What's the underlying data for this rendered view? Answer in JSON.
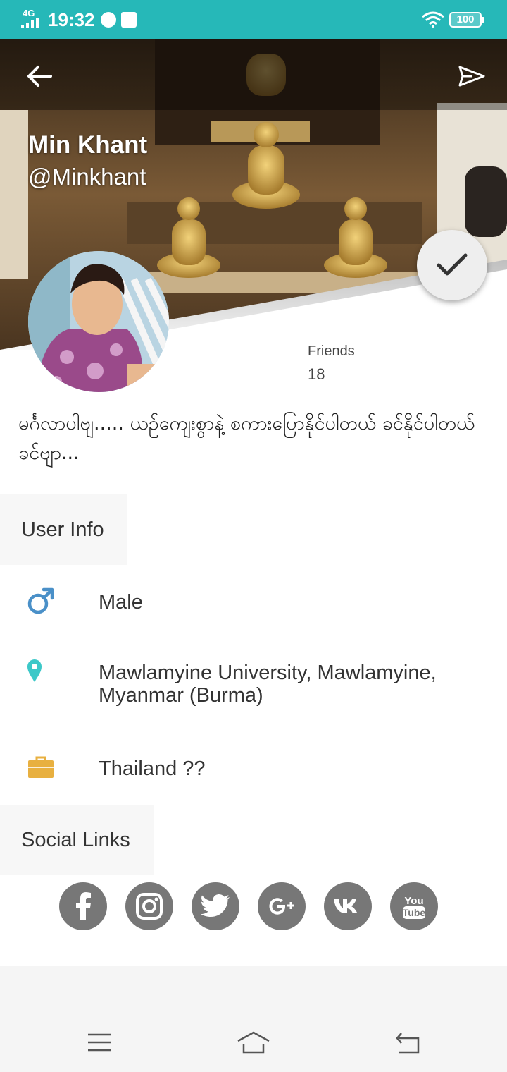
{
  "status_bar": {
    "network": "4G",
    "time": "19:32",
    "battery": "100"
  },
  "profile": {
    "name": "Min Khant",
    "handle": "@Minkhant",
    "friends_label": "Friends",
    "friends_count": "18",
    "bio": "မင်္ဂလာပါဗျ..... ယဉ်ကျေးစွာနဲ့ စကားပြောနိုင်ပါတယ် ခင်နိုင်ပါတယ်ခင်ဗျာ..."
  },
  "sections": {
    "user_info": "User Info",
    "social_links": "Social Links"
  },
  "user_info": {
    "gender": "Male",
    "education": "Mawlamyine University, Mawlamyine, Myanmar (Burma)",
    "work": "Thailand ??"
  },
  "social_links": [
    {
      "icon": "facebook-icon"
    },
    {
      "icon": "instagram-icon"
    },
    {
      "icon": "twitter-icon"
    },
    {
      "icon": "google-plus-icon",
      "text": "G+"
    },
    {
      "icon": "vk-icon",
      "text": "vk"
    },
    {
      "icon": "youtube-icon",
      "text_top": "You",
      "text_bottom": "Tube"
    }
  ],
  "colors": {
    "status_bar": "#26b8b8",
    "gender_icon": "#4a90c8",
    "location_icon": "#3cc8c8",
    "work_icon": "#e8b040",
    "social_icon_bg": "#777777"
  }
}
